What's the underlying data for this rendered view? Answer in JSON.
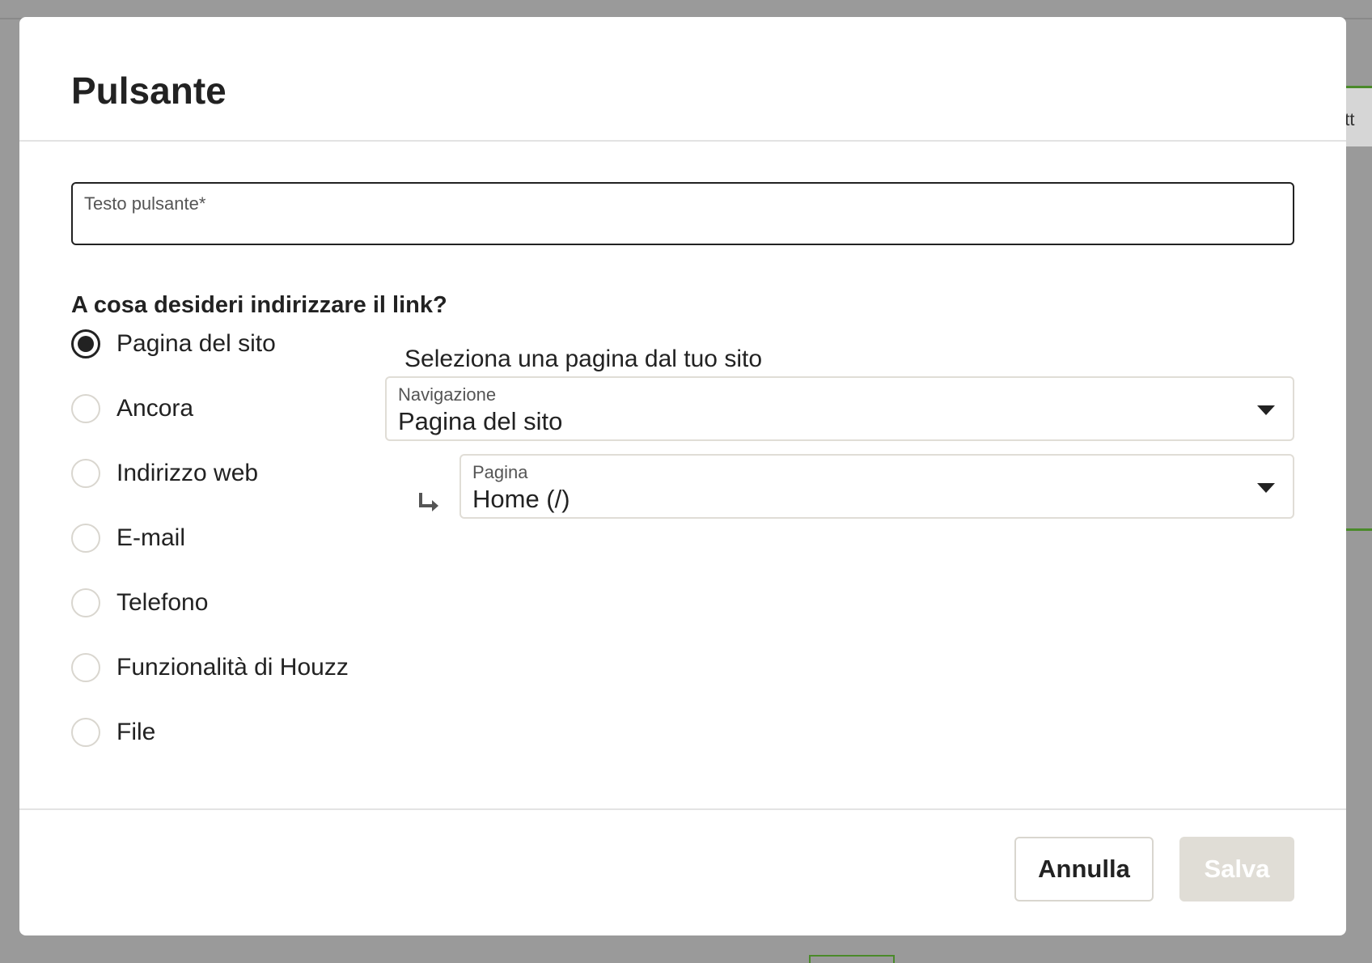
{
  "background": {
    "tab_fragment": "ett"
  },
  "modal": {
    "title": "Pulsante",
    "button_text_field": {
      "label": "Testo pulsante*",
      "value": ""
    },
    "question": "A cosa desideri indirizzare il link?",
    "link_options": [
      {
        "label": "Pagina del sito",
        "checked": true
      },
      {
        "label": "Ancora",
        "checked": false
      },
      {
        "label": "Indirizzo web",
        "checked": false
      },
      {
        "label": "E-mail",
        "checked": false
      },
      {
        "label": "Telefono",
        "checked": false
      },
      {
        "label": "Funzionalità di Houzz",
        "checked": false
      },
      {
        "label": "File",
        "checked": false
      }
    ],
    "site_page_section": {
      "heading": "Seleziona una pagina dal tuo sito",
      "navigation_select": {
        "label": "Navigazione",
        "value": "Pagina del sito"
      },
      "page_select": {
        "label": "Pagina",
        "value": "Home (/)"
      }
    },
    "footer": {
      "cancel_label": "Annulla",
      "save_label": "Salva"
    }
  },
  "colors": {
    "overlay": "#9a9a9a",
    "accent_green": "#4a8a2a",
    "save_disabled_bg": "#e0ddd6"
  },
  "icons": {
    "sub_item": "arrow-turn-down-right-icon",
    "dropdown": "caret-down-icon"
  }
}
